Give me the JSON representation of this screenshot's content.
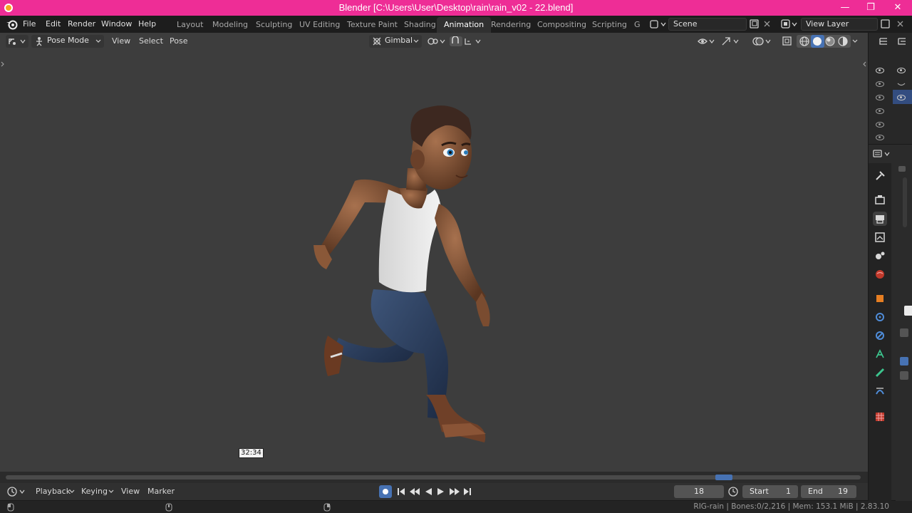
{
  "window": {
    "title": "Blender [C:\\Users\\User\\Desktop\\rain\\rain_v02 - 22.blend]",
    "minimize": "—",
    "restore": "❐",
    "close": "✕"
  },
  "menu": {
    "file": "File",
    "edit": "Edit",
    "render": "Render",
    "window": "Window",
    "help": "Help"
  },
  "workspaces": {
    "tabs": [
      "Layout",
      "Modeling",
      "Sculpting",
      "UV Editing",
      "Texture Paint",
      "Shading",
      "Animation",
      "Rendering",
      "Compositing",
      "Scripting",
      "G"
    ],
    "active": "Animation"
  },
  "scene": {
    "name": "Scene"
  },
  "view_layer": {
    "name": "View Layer"
  },
  "viewport": {
    "mode": "Pose Mode",
    "menus": {
      "view": "View",
      "select": "Select",
      "pose": "Pose"
    },
    "orientation": "Gimbal",
    "frame_tooltip": "32:34"
  },
  "timeline": {
    "playback": "Playback",
    "keying": "Keying",
    "view": "View",
    "marker": "Marker",
    "current_frame": "18",
    "start_label": "Start",
    "start_value": "1",
    "end_label": "End",
    "end_value": "19"
  },
  "status": {
    "text": "RIG-rain | Bones:0/2,216 | Mem: 153.1 MiB | 2.83.10"
  },
  "colors": {
    "title_bar": "#ee2d96",
    "viewport_bg": "#3d3d3d",
    "accent_blue": "#4772b3"
  }
}
